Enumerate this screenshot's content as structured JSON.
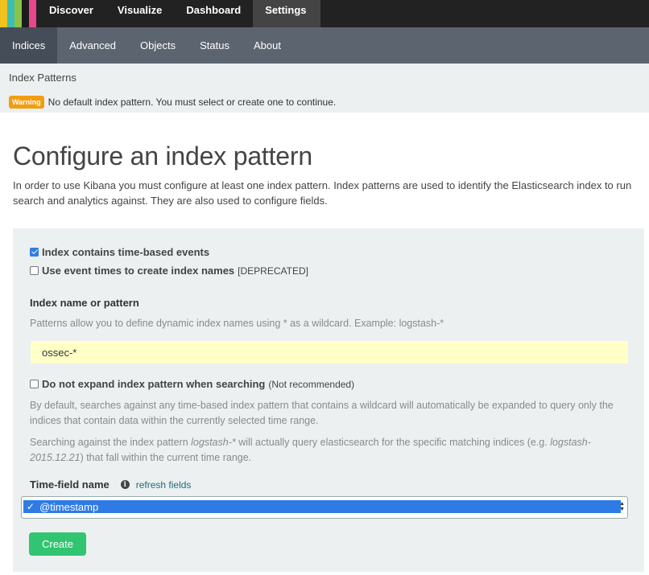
{
  "nav": {
    "tabs": [
      "Discover",
      "Visualize",
      "Dashboard",
      "Settings"
    ],
    "active": "Settings"
  },
  "subnav": {
    "tabs": [
      "Indices",
      "Advanced",
      "Objects",
      "Status",
      "About"
    ],
    "active": "Indices"
  },
  "breadcrumb": "Index Patterns",
  "warning": {
    "badge": "Warning",
    "text": "No default index pattern. You must select or create one to continue."
  },
  "page": {
    "title": "Configure an index pattern",
    "intro": "In order to use Kibana you must configure at least one index pattern. Index patterns are used to identify the Elasticsearch index to run search and analytics against. They are also used to configure fields."
  },
  "form": {
    "time_based": {
      "label": "Index contains time-based events",
      "checked": true
    },
    "event_times": {
      "label": "Use event times to create index names",
      "suffix": "[DEPRECATED]",
      "checked": false
    },
    "index_name_label": "Index name or pattern",
    "index_name_help": "Patterns allow you to define dynamic index names using * as a wildcard. Example: logstash-*",
    "index_name_value": "ossec-*",
    "no_expand": {
      "label": "Do not expand index pattern when searching",
      "suffix": "(Not recommended)",
      "checked": false
    },
    "no_expand_help": "By default, searches against any time-based index pattern that contains a wildcard will automatically be expanded to query only the indices that contain data within the currently selected time range.",
    "search_help": {
      "a": "Searching against the index pattern ",
      "b": "logstash-*",
      "c": " will actually query elasticsearch for the specific matching indices (e.g. ",
      "d": "logstash-2015.12.21",
      "e": ") that fall within the current time range."
    },
    "time_field_label": "Time-field name",
    "refresh_label": "refresh fields",
    "time_field_value": "@timestamp",
    "create_label": "Create"
  },
  "colors": {
    "logo": [
      "#f0c21f",
      "#3ebeb0",
      "#8bc34a",
      "#1b1b1b",
      "#e8488b"
    ],
    "accent_green": "#31c471",
    "warning_orange": "#f39c12",
    "select_blue": "#2f7be6"
  }
}
